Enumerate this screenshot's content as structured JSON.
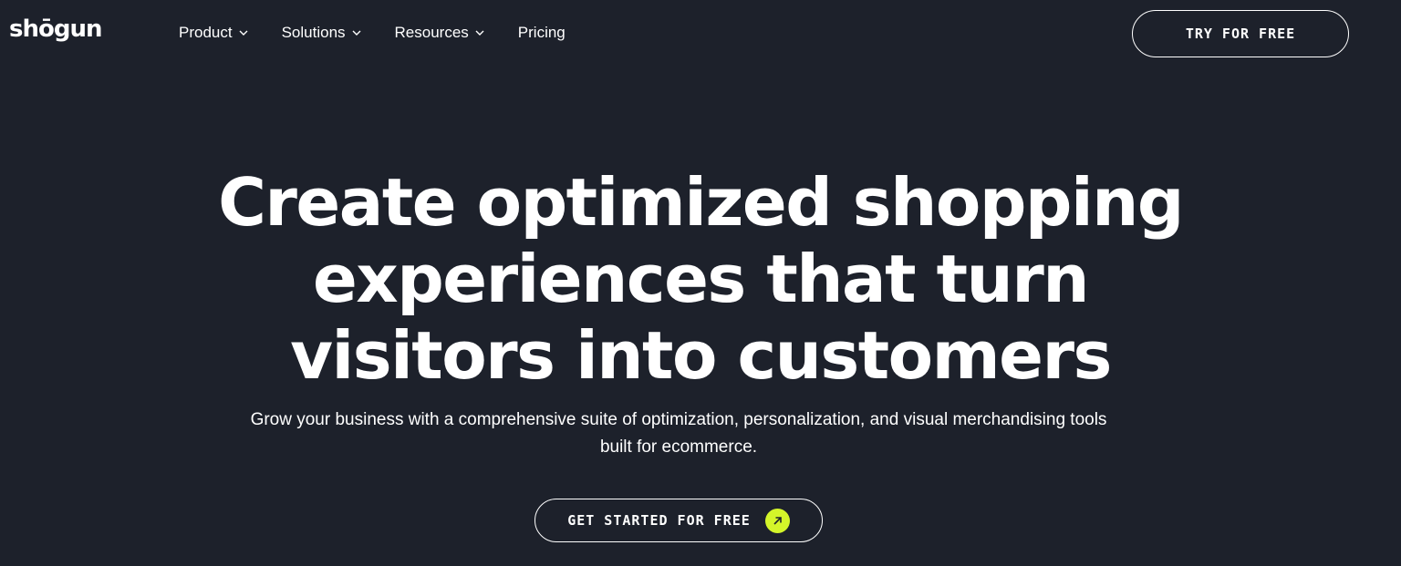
{
  "header": {
    "logo_text": "shōgun",
    "nav": [
      {
        "label": "Product",
        "has_dropdown": true
      },
      {
        "label": "Solutions",
        "has_dropdown": true
      },
      {
        "label": "Resources",
        "has_dropdown": true
      },
      {
        "label": "Pricing",
        "has_dropdown": false
      }
    ],
    "try_button": "TRY FOR FREE"
  },
  "hero": {
    "title_lines": [
      "Create optimized shopping",
      "experiences that turn",
      "visitors into customers"
    ],
    "subtitle_line1": "Grow your business with a comprehensive suite of optimization, personalization, and visual merchandising tools",
    "subtitle_line2": "built for ecommerce.",
    "cta_label": "GET STARTED FOR FREE",
    "cta_icon": "arrow-up-right-icon"
  },
  "colors": {
    "background": "#1d212b",
    "text": "#ffffff",
    "accent": "#d4f52a"
  }
}
